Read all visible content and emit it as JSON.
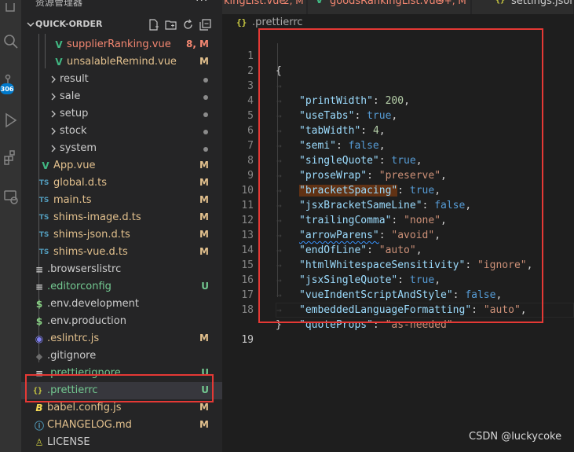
{
  "activity_bar": {
    "icons": [
      "explorer-icon",
      "search-icon",
      "source-control-icon",
      "run-debug-icon",
      "extensions-icon",
      "remote-explorer-icon"
    ],
    "scm_badge": "306",
    "badge_color": "#007acc"
  },
  "sidebar": {
    "title": "资源管理器",
    "more": "···",
    "section_title": "QUICK-ORDER",
    "items": [
      {
        "label": "supplierRanking.vue",
        "status": "8, M",
        "icon": "V"
      },
      {
        "label": "unsalableRemind.vue",
        "status": "M",
        "icon": "V"
      },
      {
        "label": "result"
      },
      {
        "label": "sale"
      },
      {
        "label": "setup"
      },
      {
        "label": "stock"
      },
      {
        "label": "system"
      },
      {
        "label": "App.vue",
        "status": "M",
        "icon": "V"
      },
      {
        "label": "global.d.ts",
        "status": "M",
        "icon": "TS"
      },
      {
        "label": "main.ts",
        "status": "M",
        "icon": "TS"
      },
      {
        "label": "shims-image.d.ts",
        "status": "M",
        "icon": "TS"
      },
      {
        "label": "shims-json.d.ts",
        "status": "M",
        "icon": "TS"
      },
      {
        "label": "shims-vue.d.ts",
        "status": "M",
        "icon": "TS"
      },
      {
        "label": ".browserslistrc",
        "icon": "≡"
      },
      {
        "label": ".editorconfig",
        "status": "U",
        "icon": "≡"
      },
      {
        "label": ".env.development",
        "icon": "$"
      },
      {
        "label": ".env.production",
        "icon": "$"
      },
      {
        "label": ".eslintrc.js",
        "status": "M",
        "icon": "◉"
      },
      {
        "label": ".gitignore",
        "icon": "◆"
      },
      {
        "label": ".prettierignore",
        "status": "U",
        "icon": "≡"
      },
      {
        "label": ".prettierrc",
        "status": "U",
        "icon": "{}"
      },
      {
        "label": "babel.config.js",
        "status": "M",
        "icon": "B"
      },
      {
        "label": "CHANGELOG.md",
        "status": "M",
        "icon": "ⓘ"
      },
      {
        "label": "LICENSE",
        "icon": "♙"
      }
    ]
  },
  "tabs": [
    {
      "label": "kingList.vue",
      "status": "2, M"
    },
    {
      "label": "goodsRankingList.vue",
      "status": "9+, M"
    },
    {
      "label": "settings.json",
      "status": ""
    }
  ],
  "breadcrumb": {
    "icon": "{}",
    "label": ".prettierrc"
  },
  "editor": {
    "line_numbers": [
      "1",
      "2",
      "3",
      "4",
      "5",
      "6",
      "7",
      "8",
      "9",
      "10",
      "11",
      "12",
      "13",
      "14",
      "15",
      "16",
      "17",
      "18",
      "19"
    ],
    "lines": [
      {
        "open": "{"
      },
      {
        "key": "\"printWidth\"",
        "value": "200",
        "type": "num"
      },
      {
        "key": "\"useTabs\"",
        "value": "true",
        "type": "bool"
      },
      {
        "key": "\"tabWidth\"",
        "value": "4",
        "type": "num"
      },
      {
        "key": "\"semi\"",
        "value": "false",
        "type": "bool"
      },
      {
        "key": "\"singleQuote\"",
        "value": "true",
        "type": "bool"
      },
      {
        "key": "\"proseWrap\"",
        "value": "\"preserve\"",
        "type": "str"
      },
      {
        "key": "\"bracketSpacing\"",
        "value": "true",
        "type": "bool"
      },
      {
        "key": "\"jsxBracketSameLine\"",
        "value": "false",
        "type": "bool"
      },
      {
        "key": "\"trailingComma\"",
        "value": "\"none\"",
        "type": "str"
      },
      {
        "key": "\"arrowParens\"",
        "value": "\"avoid\"",
        "type": "str"
      },
      {
        "key": "\"endOfLine\"",
        "value": "\"auto\"",
        "type": "str"
      },
      {
        "key": "\"htmlWhitespaceSensitivity\"",
        "value": "\"ignore\"",
        "type": "str"
      },
      {
        "key": "\"jsxSingleQuote\"",
        "value": "true",
        "type": "bool"
      },
      {
        "key": "\"vueIndentScriptAndStyle\"",
        "value": "false",
        "type": "bool"
      },
      {
        "key": "\"embeddedLanguageFormatting\"",
        "value": "\"auto\"",
        "type": "str"
      },
      {
        "key": "\"quoteProps\"",
        "value": "\"as-needed\"",
        "type": "str"
      },
      {
        "close": "}"
      },
      {}
    ]
  },
  "watermark": "CSDN @luckycoke",
  "colors": {
    "annotation_red": "#e53935",
    "modified": "#e2c08d",
    "untracked": "#73c991",
    "error": "#f48771"
  }
}
